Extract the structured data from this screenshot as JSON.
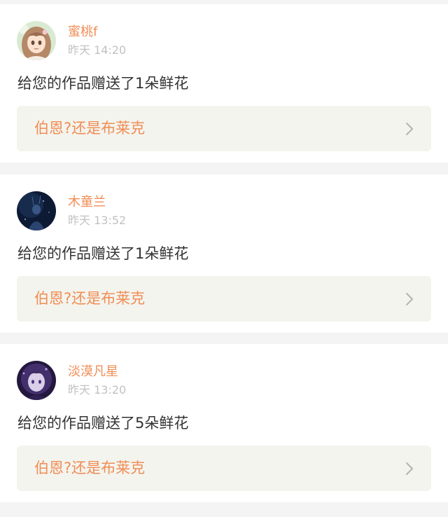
{
  "notifications": [
    {
      "username": "蜜桃f",
      "time": "昨天 14:20",
      "message": "给您的作品赠送了1朵鲜花",
      "work_title": "伯恩?还是布莱克",
      "avatar_icon": "anime-girl-avatar"
    },
    {
      "username": "木童兰",
      "time": "昨天 13:52",
      "message": "给您的作品赠送了1朵鲜花",
      "work_title": "伯恩?还是布莱克",
      "avatar_icon": "dark-night-avatar"
    },
    {
      "username": "淡漠凡星",
      "time": "昨天 13:20",
      "message": "给您的作品赠送了5朵鲜花",
      "work_title": "伯恩?还是布莱克",
      "avatar_icon": "purple-anime-avatar"
    }
  ],
  "colors": {
    "accent": "#f08d55",
    "timestamp": "#c2c2c2",
    "text": "#333333",
    "link_bg": "#f4f4ee",
    "page_bg": "#f4f4f4"
  }
}
